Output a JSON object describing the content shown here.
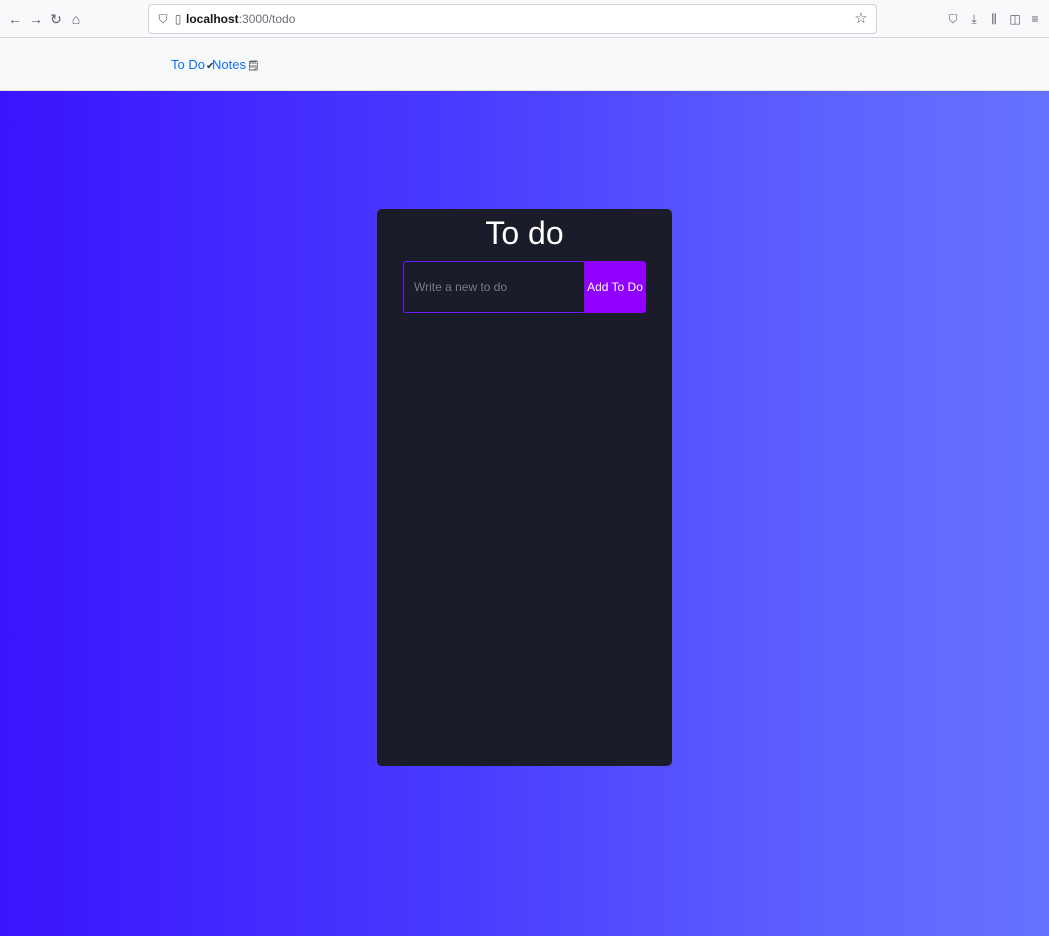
{
  "browser": {
    "url_host": "localhost",
    "url_path": ":3000/todo",
    "icons": {
      "back": "back-arrow-icon",
      "forward": "forward-arrow-icon",
      "reload": "reload-icon",
      "home": "home-icon",
      "shield": "shield-icon",
      "page": "page-icon",
      "star": "bookmark-star-icon",
      "pocket": "pocket-icon",
      "download": "download-icon",
      "library": "library-icon",
      "sidebar": "sidebar-icon",
      "menu": "hamburger-menu-icon"
    }
  },
  "navbar": {
    "links": [
      {
        "label": "To Do",
        "icon": "check-icon"
      },
      {
        "label": "Notes",
        "icon": "note-icon"
      }
    ],
    "link_color": "#0d6efd"
  },
  "colors": {
    "gradient_start": "#3a14fd",
    "gradient_end": "#6671ff",
    "card_bg": "#1b1c29",
    "button_bg": "#9000ff",
    "input_border": "#6a1cff"
  },
  "todo": {
    "title": "To do",
    "input_value": "",
    "input_placeholder": "Write a new to do",
    "add_button_label": "Add To Do",
    "items": []
  }
}
